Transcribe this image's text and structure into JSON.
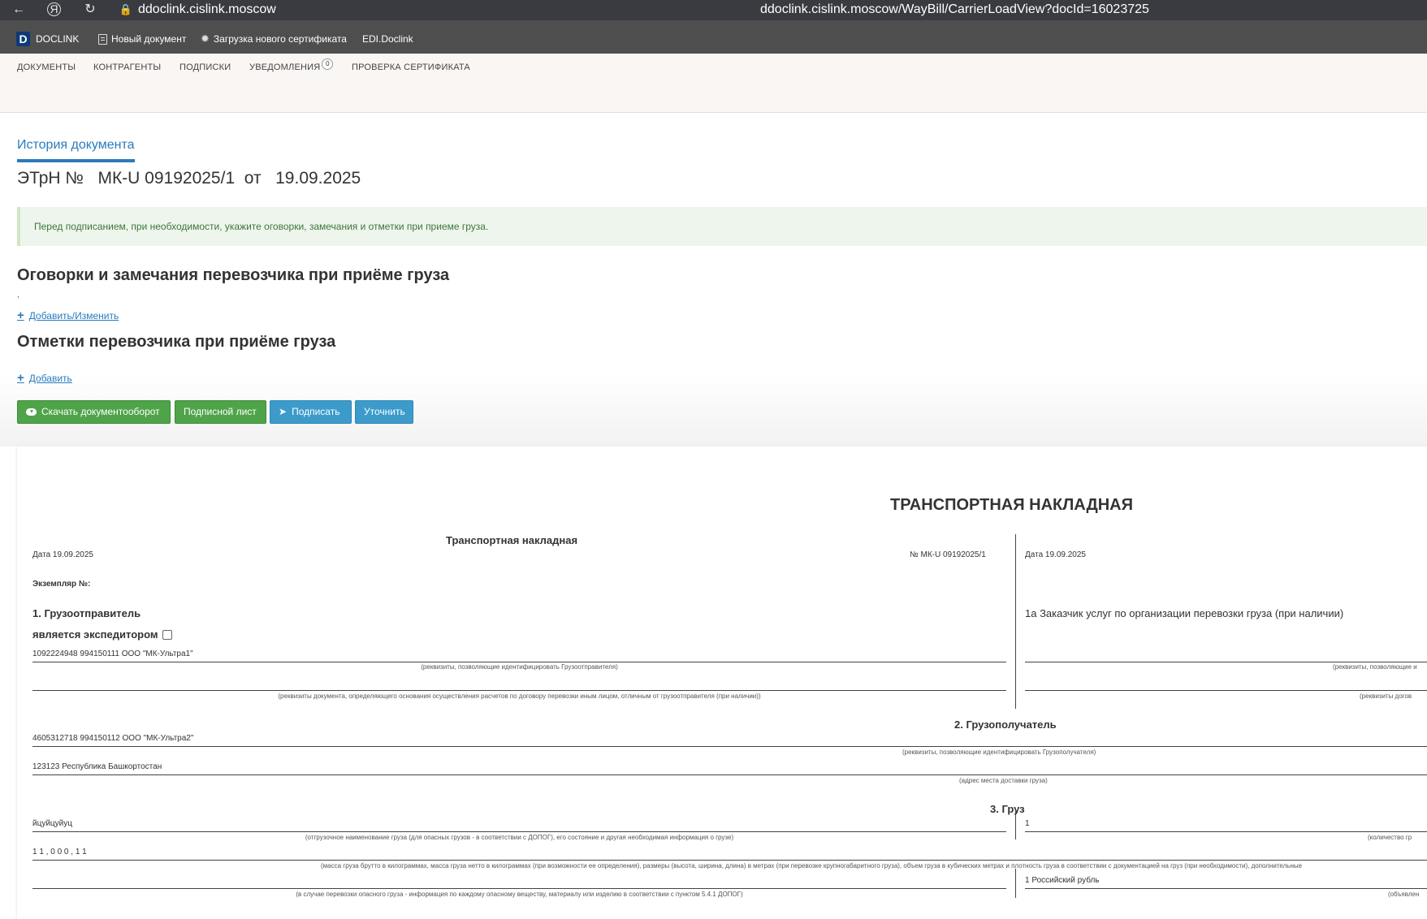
{
  "browser": {
    "url_host": "ddoclink.cislink.moscow",
    "url_full": "ddoclink.cislink.moscow/WayBill/CarrierLoadView?docId=16023725"
  },
  "app_bar": {
    "logo_letter": "D",
    "logo_text": "DOCLINK",
    "new_doc": "Новый документ",
    "upload_cert": "Загрузка нового сертификата",
    "edi": "EDI.Doclink"
  },
  "menu": {
    "documents": "ДОКУМЕНТЫ",
    "contractors": "КОНТРАГЕНТЫ",
    "signatures": "ПОДПИСКИ",
    "notifications": "УВЕДОМЛЕНИЯ",
    "notifications_count": "0",
    "cert_check": "ПРОВЕРКА СЕРТИФИКАТА"
  },
  "page": {
    "history_tab": "История документа",
    "doc_title": "ЭТрН №   МК-U 09192025/1  от   19.09.2025",
    "alert": "Перед подписанием, при необходимости, укажите оговорки, замечания и отметки при приеме груза.",
    "remarks_heading": "Оговорки и замечания перевозчика при приёме груза",
    "remarks_value": ",",
    "add_edit": "Добавить/Изменить",
    "marks_heading": "Отметки перевозчика при приёме груза",
    "add": "Добавить"
  },
  "buttons": {
    "download": "Скачать документооборот",
    "sign_sheet": "Подписной лист",
    "sign": "Подписать",
    "clarify": "Уточнить"
  },
  "waybill": {
    "main_title": "ТРАНСПОРТНАЯ НАКЛАДНАЯ",
    "sub_title": "Транспортная накладная",
    "date_left": "Дата  19.09.2025",
    "number": "№   МК-U 09192025/1",
    "date_right": "Дата 19.09.2025",
    "copy_no": "Экземпляр №:",
    "shipper_heading": "1. Грузоотправитель",
    "is_forwarder": "является экспедитором",
    "customer_heading": "1а Заказчик услуг по организации перевозки груза (при наличии)",
    "shipper_value": "1092224948 994150111 ООО \"МК-Ультра1\"",
    "shipper_cap": "(реквизиты, позволяющие идентифицировать Грузоотправителя)",
    "shipper_doc_cap": "(реквизиты документа, определяющего основания осуществления расчетов по договору перевозки иным лицом, отличным от грузоотправителя (при наличии))",
    "customer_cap1": "(реквизиты, позволяющие и",
    "customer_cap2": "(реквизиты догов",
    "consignee_heading": "2. Грузополучатель",
    "consignee_value": "4605312718 994150112 ООО \"МК-Ультра2\"",
    "consignee_cap": "(реквизиты, позволяющие идентифицировать Грузополучателя)",
    "address_value": "123123 Республика Башкортостан",
    "address_cap": "(адрес места доставки груза)",
    "cargo_heading": "3. Груз",
    "cargo_name": "йцуйцуйуц",
    "cargo_name_cap": "(отгрузочное наименование груза (для опасных грузов - в соответствии с ДОПОГ), его состояние и другая необходимая информация о грузе)",
    "cargo_qty": "1",
    "cargo_qty_cap": "(количество гр",
    "cargo_mass": "1 1 , 0 0 0 , 1 1",
    "cargo_mass_cap": "(масса груза брутто в килограммах, масса груза нетто в килограммах (при возможности ее определения), размеры (высота, ширина, длина) в метрах (при перевозке крупногабаритного груза), объем груза в кубических метрах и плотность груза в соответствии с документацией на груз (при необходимости), дополнительные",
    "currency": "1 Российский рубль",
    "dangerous_cap": "(в случае перевозки опасного груза - информация по каждому опасному веществу, материалу или изделию в соответствии с пунктом 5.4.1 ДОПОГ)",
    "declared_cap": "(объявлен"
  }
}
